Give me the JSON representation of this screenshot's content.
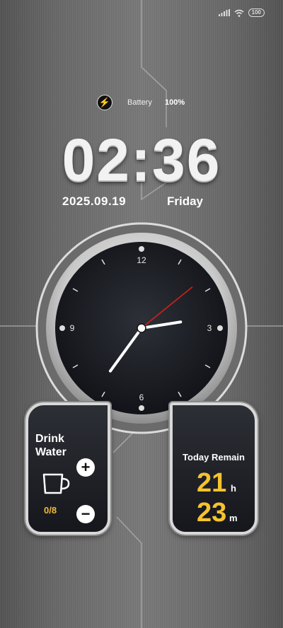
{
  "status_bar": {
    "signal_icon": "signal-bars-icon",
    "wifi_icon": "wifi-icon",
    "battery_level": "100"
  },
  "battery": {
    "icon": "lightning-bolt-icon",
    "label": "Battery",
    "value": "100%"
  },
  "clock": {
    "time": "02:36",
    "date": "2025.09.19",
    "day": "Friday"
  },
  "analog_clock": {
    "numbers": [
      "12",
      "3",
      "6",
      "9"
    ],
    "hour_value": 7.2,
    "minute_value": 13.5,
    "second_value": 8.5,
    "second_hand_color": "#d0201a"
  },
  "drink_water": {
    "title_line1": "Drink",
    "title_line2": "Water",
    "count": "0/8",
    "plus_label": "+",
    "minus_label": "−"
  },
  "today_remain": {
    "title": "Today Remain",
    "hours": "21",
    "hours_unit": "h",
    "minutes": "23",
    "minutes_unit": "m"
  },
  "colors": {
    "accent": "#f5c32e",
    "card_bg": "#1e2026"
  }
}
